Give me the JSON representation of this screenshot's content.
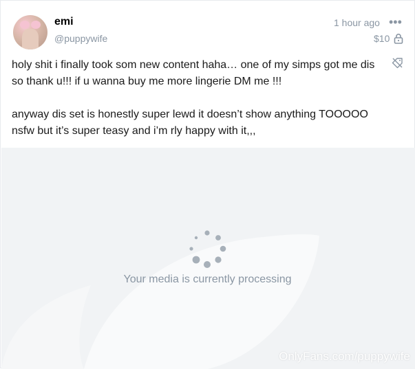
{
  "post": {
    "author_name": "emi",
    "author_handle": "@puppywife",
    "timestamp": "1 hour ago",
    "more_icon": "ellipsis-icon",
    "price": "$10",
    "lock_icon": "lock-icon",
    "tag_icon": "price-tag-off-icon",
    "text_paragraphs": [
      "holy shit i finally took som new content haha… one of my simps got me dis so thank u!!! if u wanna buy me more lingerie DM me !!!",
      "anyway dis set is honestly super lewd it doesn’t show anything TOOOOO nsfw but it’s super teasy and i’m rly happy with it,,,"
    ]
  },
  "media": {
    "status_text": "Your media is currently processing",
    "watermark": "OnlyFans.com/puppywife",
    "spinner_icon": "loading-spinner-icon",
    "background_color": "#f1f3f5"
  },
  "colors": {
    "muted_text": "#8a96a3",
    "body_text": "#1a1a1a",
    "name_text": "#000000"
  }
}
